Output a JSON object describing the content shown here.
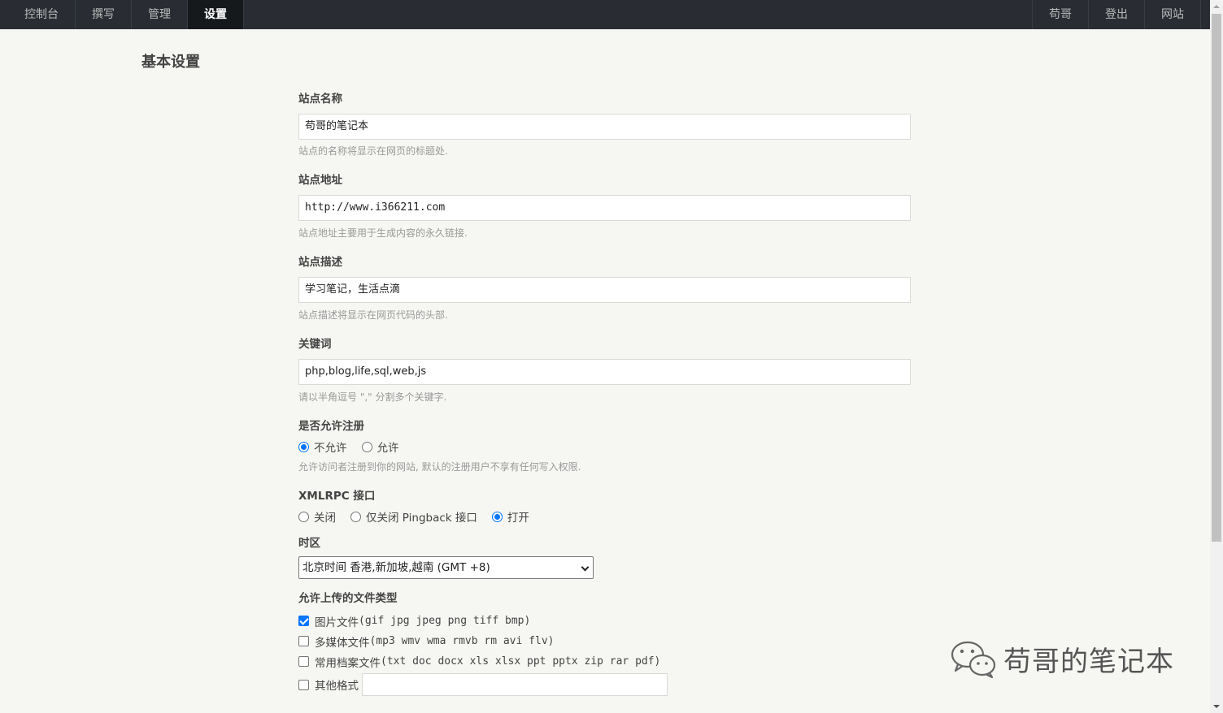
{
  "nav": {
    "left": [
      "控制台",
      "撰写",
      "管理",
      "设置"
    ],
    "active": "设置",
    "right": [
      "苟哥",
      "登出",
      "网站"
    ]
  },
  "page_title": "基本设置",
  "site_name": {
    "label": "站点名称",
    "value": "苟哥的笔记本",
    "desc": "站点的名称将显示在网页的标题处."
  },
  "site_url": {
    "label": "站点地址",
    "value": "http://www.i366211.com",
    "desc": "站点地址主要用于生成内容的永久链接."
  },
  "site_desc": {
    "label": "站点描述",
    "value": "学习笔记，生活点滴",
    "desc": "站点描述将显示在网页代码的头部."
  },
  "keywords": {
    "label": "关键词",
    "value": "php,blog,life,sql,web,js",
    "desc": "请以半角逗号 \",\" 分割多个关键字."
  },
  "register": {
    "label": "是否允许注册",
    "options": [
      "不允许",
      "允许"
    ],
    "selected": "不允许",
    "desc": "允许访问者注册到你的网站, 默认的注册用户不享有任何写入权限."
  },
  "xmlrpc": {
    "label": "XMLRPC 接口",
    "options": [
      "关闭",
      "仅关闭 Pingback 接口",
      "打开"
    ],
    "selected": "打开"
  },
  "timezone": {
    "label": "时区",
    "value": "北京时间 香港,新加坡,越南 (GMT +8)"
  },
  "upload_types": {
    "label": "允许上传的文件类型",
    "items": [
      {
        "name": "图片文件",
        "ext": "(gif jpg jpeg png tiff bmp)",
        "checked": true
      },
      {
        "name": "多媒体文件",
        "ext": "(mp3 wmv wma rmvb rm avi flv)",
        "checked": false
      },
      {
        "name": "常用档案文件",
        "ext": "(txt doc docx xls xlsx ppt pptx zip rar pdf)",
        "checked": false
      }
    ],
    "other_label": "其他格式",
    "other_value": ""
  },
  "watermark": {
    "text": "苟哥的笔记本",
    "icon": "wechat-icon"
  }
}
